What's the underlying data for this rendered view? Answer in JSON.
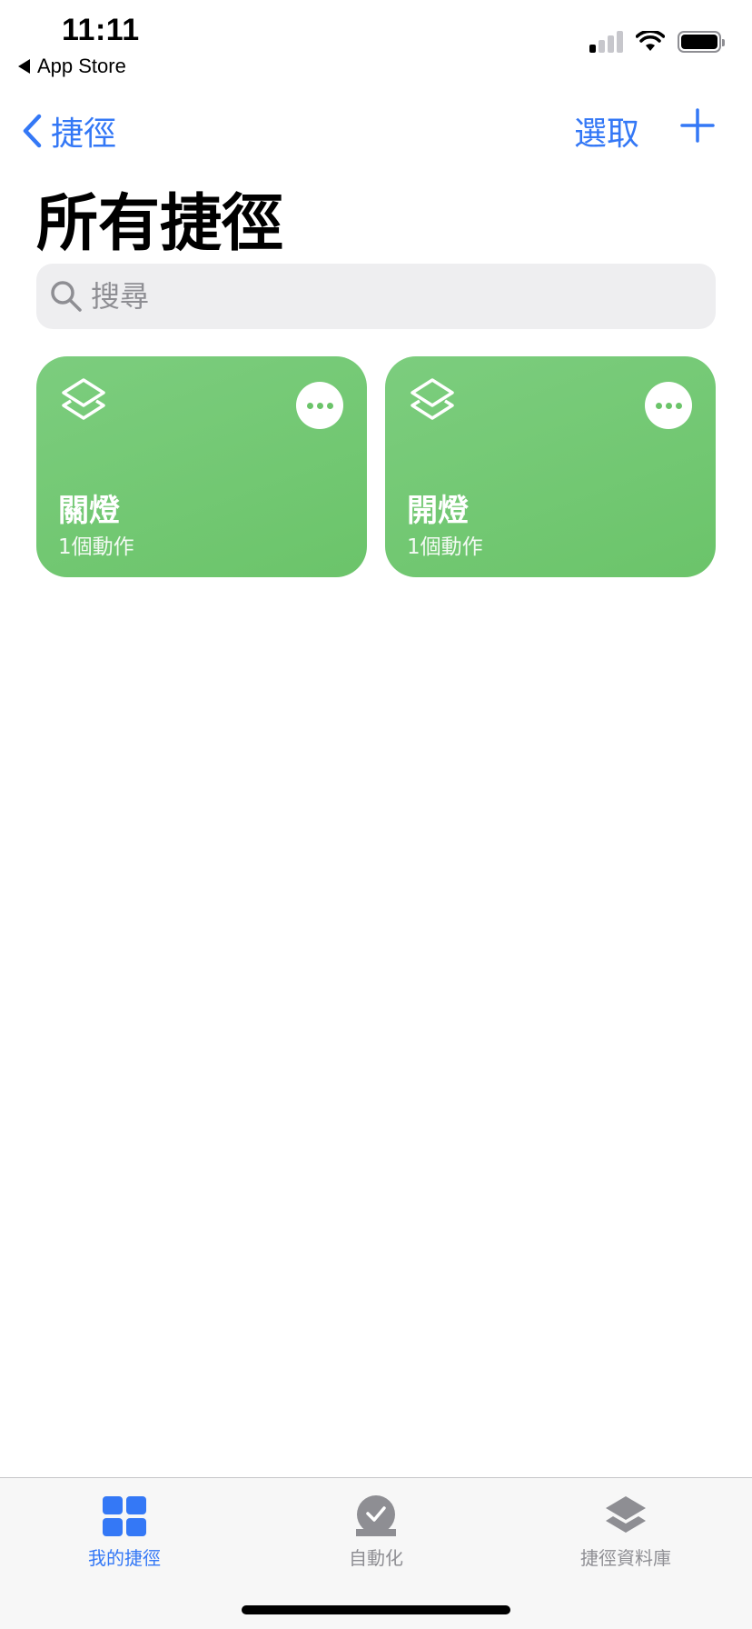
{
  "status_bar": {
    "time": "11:11",
    "back_app": "App Store",
    "signal_bars_on": 1,
    "signal_bars_total": 4,
    "battery_level": 1.0
  },
  "nav": {
    "back_label": "捷徑",
    "select_label": "選取",
    "add_icon": "plus-icon",
    "accent_color": "#3478f6"
  },
  "page": {
    "title": "所有捷徑"
  },
  "search": {
    "placeholder": "搜尋",
    "value": ""
  },
  "shortcuts": [
    {
      "name": "關燈",
      "actions": "1個動作",
      "color": "#6bc46a",
      "icon": "layers-icon"
    },
    {
      "name": "開燈",
      "actions": "1個動作",
      "color": "#6bc46a",
      "icon": "layers-icon"
    }
  ],
  "tabbar": {
    "items": [
      {
        "label": "我的捷徑",
        "icon": "grid-icon",
        "active": true
      },
      {
        "label": "自動化",
        "icon": "clock-check-icon",
        "active": false
      },
      {
        "label": "捷徑資料庫",
        "icon": "layers-icon",
        "active": false
      }
    ]
  }
}
